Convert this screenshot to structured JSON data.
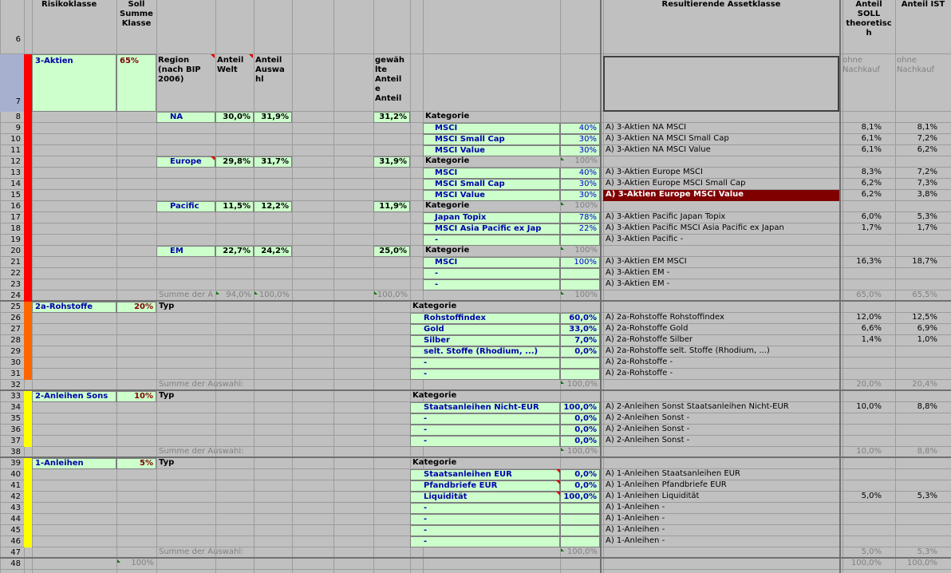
{
  "headers": {
    "row_num": "6",
    "risikoklasse": "Risikoklasse",
    "soll_summe": "Soll\nSumme\nKlasse",
    "resultierende": "Resultierende Assetklasse",
    "anteil_soll": "Anteil\nSOLL\ntheoretisc\nh",
    "anteil_ist": "Anteil IST"
  },
  "row7": {
    "num": "7",
    "klasse": "3-Aktien",
    "pct": "65%",
    "region": "Region\n(nach BIP\n2006)",
    "anteil_welt": "Anteil\nWelt",
    "anteil_auswahl": "Anteil\nAuswa\nhl",
    "gewaehlte": "gewäh\nlte\nAnteil\ne\nAnteil",
    "ohne1": "ohne\nNachkauf",
    "ohne2": "ohne\nNachkauf"
  },
  "aktien_rows": [
    {
      "num": "8",
      "region": "NA",
      "welt": "30,0%",
      "auswahl": "31,9%",
      "gew": "31,2%",
      "kat": "Kategorie",
      "pct": "",
      "asset": "",
      "soll": "",
      "ist": ""
    },
    {
      "num": "9",
      "region": "",
      "welt": "",
      "auswahl": "",
      "gew": "",
      "kat": "MSCI",
      "pct": "40%",
      "asset": "A) 3-Aktien NA MSCI",
      "soll": "8,1%",
      "ist": "8,1%"
    },
    {
      "num": "10",
      "region": "",
      "welt": "",
      "auswahl": "",
      "gew": "",
      "kat": "MSCI Small Cap",
      "pct": "30%",
      "asset": "A) 3-Aktien NA MSCI Small Cap",
      "soll": "6,1%",
      "ist": "7,2%"
    },
    {
      "num": "11",
      "region": "",
      "welt": "",
      "auswahl": "",
      "gew": "",
      "kat": "MSCI Value",
      "pct": "30%",
      "asset": "A) 3-Aktien NA MSCI Value",
      "soll": "6,1%",
      "ist": "6,2%"
    },
    {
      "num": "12",
      "region": "Europe",
      "welt": "29,8%",
      "auswahl": "31,7%",
      "gew": "31,9%",
      "kat": "Kategorie",
      "pct": "100%",
      "asset": "",
      "soll": "",
      "ist": ""
    },
    {
      "num": "13",
      "region": "",
      "welt": "",
      "auswahl": "",
      "gew": "",
      "kat": "MSCI",
      "pct": "40%",
      "asset": "A) 3-Aktien Europe MSCI",
      "soll": "8,3%",
      "ist": "7,2%"
    },
    {
      "num": "14",
      "region": "",
      "welt": "",
      "auswahl": "",
      "gew": "",
      "kat": "MSCI Small Cap",
      "pct": "30%",
      "asset": "A) 3-Aktien Europe MSCI Small Cap",
      "soll": "6,2%",
      "ist": "7,3%"
    },
    {
      "num": "15",
      "region": "",
      "welt": "",
      "auswahl": "",
      "gew": "",
      "kat": "MSCI Value",
      "pct": "30%",
      "asset": "A) 3-Aktien Europe MSCI Value",
      "soll": "6,2%",
      "ist": "3,8%"
    },
    {
      "num": "16",
      "region": "Pacific",
      "welt": "11,5%",
      "auswahl": "12,2%",
      "gew": "11,9%",
      "kat": "Kategorie",
      "pct": "100%",
      "asset": "",
      "soll": "",
      "ist": ""
    },
    {
      "num": "17",
      "region": "",
      "welt": "",
      "auswahl": "",
      "gew": "",
      "kat": "Japan Topix",
      "pct": "78%",
      "asset": "A) 3-Aktien Pacific Japan Topix",
      "soll": "6,0%",
      "ist": "5,3%"
    },
    {
      "num": "18",
      "region": "",
      "welt": "",
      "auswahl": "",
      "gew": "",
      "kat": "MSCI Asia Pacific ex Jap",
      "pct": "22%",
      "asset": "A) 3-Aktien Pacific MSCI Asia Pacific ex Japan",
      "soll": "1,7%",
      "ist": "1,7%"
    },
    {
      "num": "19",
      "region": "",
      "welt": "",
      "auswahl": "",
      "gew": "",
      "kat": "-",
      "pct": "",
      "asset": "A) 3-Aktien Pacific -",
      "soll": "",
      "ist": ""
    },
    {
      "num": "20",
      "region": "EM",
      "welt": "22,7%",
      "auswahl": "24,2%",
      "gew": "25,0%",
      "kat": "Kategorie",
      "pct": "100%",
      "asset": "",
      "soll": "",
      "ist": ""
    },
    {
      "num": "21",
      "region": "",
      "welt": "",
      "auswahl": "",
      "gew": "",
      "kat": "MSCI",
      "pct": "100%",
      "asset": "A) 3-Aktien EM MSCI",
      "soll": "16,3%",
      "ist": "18,7%"
    },
    {
      "num": "22",
      "region": "",
      "welt": "",
      "auswahl": "",
      "gew": "",
      "kat": "-",
      "pct": "",
      "asset": "A) 3-Aktien EM -",
      "soll": "",
      "ist": ""
    },
    {
      "num": "23",
      "region": "",
      "welt": "",
      "auswahl": "",
      "gew": "",
      "kat": "-",
      "pct": "",
      "asset": "A) 3-Aktien EM -",
      "soll": "",
      "ist": ""
    }
  ],
  "row24": {
    "num": "24",
    "label": "Summe der A",
    "welt": "94,0%",
    "auswahl": "100,0%",
    "gew": "100,0%",
    "pct": "100%",
    "soll": "65,0%",
    "ist": "65,5%"
  },
  "rohstoffe": {
    "header": {
      "num": "25",
      "klasse": "2a-Rohstoffe",
      "pct": "20%",
      "typ": "Typ",
      "kat": "Kategorie"
    },
    "rows": [
      {
        "num": "26",
        "kat": "Rohstoffindex",
        "pct": "60,0%",
        "asset": "A) 2a-Rohstoffe Rohstoffindex",
        "soll": "12,0%",
        "ist": "12,5%"
      },
      {
        "num": "27",
        "kat": "Gold",
        "pct": "33,0%",
        "asset": "A) 2a-Rohstoffe Gold",
        "soll": "6,6%",
        "ist": "6,9%"
      },
      {
        "num": "28",
        "kat": "Silber",
        "pct": "7,0%",
        "asset": "A) 2a-Rohstoffe Silber",
        "soll": "1,4%",
        "ist": "1,0%"
      },
      {
        "num": "29",
        "kat": "selt. Stoffe (Rhodium, ...)",
        "pct": "0,0%",
        "asset": "A) 2a-Rohstoffe selt. Stoffe (Rhodium, ...)",
        "soll": "",
        "ist": ""
      },
      {
        "num": "30",
        "kat": "-",
        "pct": "",
        "asset": "A) 2a-Rohstoffe -",
        "soll": "",
        "ist": ""
      },
      {
        "num": "31",
        "kat": "-",
        "pct": "",
        "asset": "A) 2a-Rohstoffe -",
        "soll": "",
        "ist": ""
      }
    ],
    "sum": {
      "num": "32",
      "label": "Summe der Auswahl:",
      "pct": "100,0%",
      "soll": "20,0%",
      "ist": "20,4%"
    }
  },
  "anleihen_sonst": {
    "header": {
      "num": "33",
      "klasse": "2-Anleihen Sons",
      "pct": "10%",
      "typ": "Typ",
      "kat": "Kategorie"
    },
    "rows": [
      {
        "num": "34",
        "kat": "Staatsanleihen Nicht-EUR",
        "pct": "100,0%",
        "asset": "A) 2-Anleihen Sonst Staatsanleihen Nicht-EUR",
        "soll": "10,0%",
        "ist": "8,8%"
      },
      {
        "num": "35",
        "kat": "-",
        "pct": "0,0%",
        "asset": "A) 2-Anleihen Sonst -",
        "soll": "",
        "ist": ""
      },
      {
        "num": "36",
        "kat": "-",
        "pct": "0,0%",
        "asset": "A) 2-Anleihen Sonst -",
        "soll": "",
        "ist": ""
      },
      {
        "num": "37",
        "kat": "-",
        "pct": "0,0%",
        "asset": "A) 2-Anleihen Sonst -",
        "soll": "",
        "ist": ""
      }
    ],
    "sum": {
      "num": "38",
      "label": "Summe der Auswahl:",
      "pct": "100,0%",
      "soll": "10,0%",
      "ist": "8,8%"
    }
  },
  "anleihen": {
    "header": {
      "num": "39",
      "klasse": "1-Anleihen",
      "pct": "5%",
      "typ": "Typ",
      "kat": "Kategorie"
    },
    "rows": [
      {
        "num": "40",
        "kat": "Staatsanleihen EUR",
        "pct": "0,0%",
        "asset": "A) 1-Anleihen Staatsanleihen EUR",
        "soll": "",
        "ist": ""
      },
      {
        "num": "41",
        "kat": "Pfandbriefe EUR",
        "pct": "0,0%",
        "asset": "A) 1-Anleihen Pfandbriefe EUR",
        "soll": "",
        "ist": ""
      },
      {
        "num": "42",
        "kat": "Liquidität",
        "pct": "100,0%",
        "asset": "A) 1-Anleihen Liquidität",
        "soll": "5,0%",
        "ist": "5,3%"
      },
      {
        "num": "43",
        "kat": "-",
        "pct": "",
        "asset": "A) 1-Anleihen -",
        "soll": "",
        "ist": ""
      },
      {
        "num": "44",
        "kat": "-",
        "pct": "",
        "asset": "A) 1-Anleihen -",
        "soll": "",
        "ist": ""
      },
      {
        "num": "45",
        "kat": "-",
        "pct": "",
        "asset": "A) 1-Anleihen -",
        "soll": "",
        "ist": ""
      },
      {
        "num": "46",
        "kat": "-",
        "pct": "",
        "asset": "A) 1-Anleihen -",
        "soll": "",
        "ist": ""
      }
    ],
    "sum": {
      "num": "47",
      "label": "Summe der Auswahl:",
      "pct": "100,0%",
      "soll": "5,0%",
      "ist": "5,3%"
    }
  },
  "row48": {
    "num": "48",
    "pct": "100%",
    "soll": "100,0%",
    "ist": "100,0%"
  },
  "colors": {
    "aktien": "#ff0000",
    "rohstoffe": "#ff6600",
    "anleihen_sonst": "#ffff00",
    "anleihen": "#ffff00",
    "highlight": "#800000",
    "cell": "#ccffcc"
  }
}
